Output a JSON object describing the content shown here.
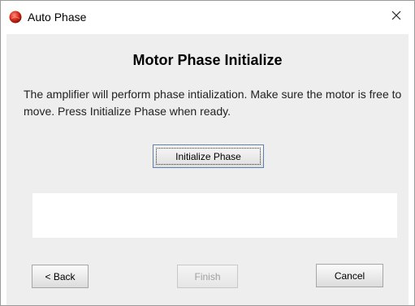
{
  "window": {
    "title": "Auto Phase",
    "app_icon": "red-sphere-icon",
    "close_icon": "close-icon"
  },
  "dialog": {
    "heading": "Motor Phase Initialize",
    "message": "The amplifier  will perform phase intialization. Make sure the motor is free to move.  Press Initialize Phase when ready.",
    "initialize_label": "Initialize Phase",
    "status_text": ""
  },
  "footer": {
    "back_label": "< Back",
    "finish_label": "Finish",
    "cancel_label": "Cancel"
  },
  "colors": {
    "client_background": "#eeeeee",
    "finish_disabled_text": "#a0a0a0"
  }
}
